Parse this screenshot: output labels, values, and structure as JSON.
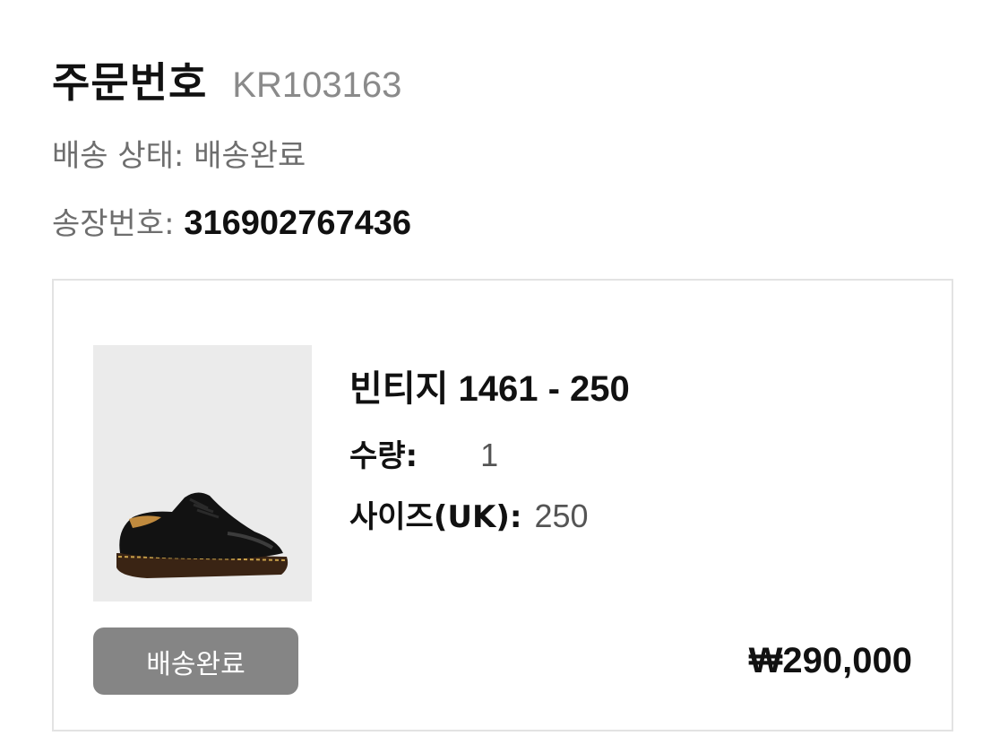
{
  "order": {
    "title": "주문번호",
    "number": "KR103163",
    "status_line": "배송 상태: 배송완료",
    "tracking_label": "송장번호: ",
    "tracking_number": "316902767436"
  },
  "item": {
    "name": "빈티지 1461 - 250",
    "image_icon": "black-leather-shoe-icon",
    "quantity_label": "수량:",
    "quantity_value": "1",
    "size_label": "사이즈(UK):",
    "size_value": "250",
    "status_button_label": "배송완료",
    "price": "₩290,000"
  },
  "colors": {
    "card_border": "#e3e3e3",
    "button_bg": "#858585",
    "image_bg": "#ebebeb",
    "muted_text": "#6e6e6e"
  }
}
